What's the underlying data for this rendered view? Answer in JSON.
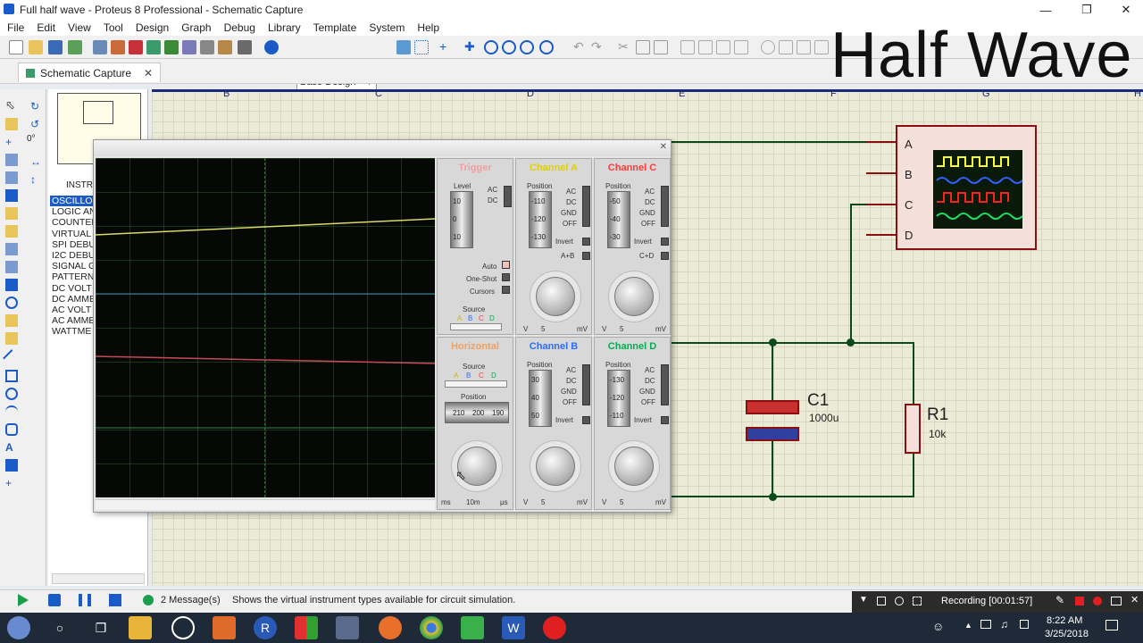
{
  "window": {
    "title": "Full half wave - Proteus 8 Professional - Schematic Capture"
  },
  "menu": [
    "File",
    "Edit",
    "View",
    "Tool",
    "Design",
    "Graph",
    "Debug",
    "Library",
    "Template",
    "System",
    "Help"
  ],
  "toolbar": {
    "design_select": "Base Design"
  },
  "tab": {
    "label": "Schematic Capture"
  },
  "overlay_text": "Half Wave",
  "left_panel": {
    "rotation": "0°",
    "header": "INSTR",
    "devices": [
      "OSCILLOS",
      "LOGIC AN",
      "COUNTER",
      "VIRTUAL",
      "SPI DEBU",
      "I2C DEBU",
      "SIGNAL G",
      "PATTERN",
      "DC VOLT",
      "DC AMME",
      "AC VOLT",
      "AC AMME",
      "WATTME"
    ]
  },
  "ruler": [
    "B",
    "C",
    "D",
    "E",
    "F",
    "G",
    "H"
  ],
  "scope": {
    "trigger": {
      "title": "Trigger",
      "level_label": "Level",
      "ac": "AC",
      "dc": "DC",
      "level_ticks": [
        "10",
        "0",
        "10"
      ],
      "auto": "Auto",
      "one_shot": "One-Shot",
      "cursors": "Cursors",
      "source_label": "Source",
      "sources": [
        "A",
        "B",
        "C",
        "D"
      ]
    },
    "horizontal": {
      "title": "Horizontal",
      "source_label": "Source",
      "sources": [
        "A",
        "B",
        "C",
        "D"
      ],
      "position_label": "Position",
      "position_ticks": [
        "210",
        "200",
        "190"
      ],
      "units": [
        "ms",
        "10m",
        "µs"
      ]
    },
    "channels": [
      {
        "title": "Channel A",
        "color": "#f2e600",
        "position_label": "Position",
        "ticks": [
          "-110",
          "-120",
          "-130"
        ],
        "modes": [
          "AC",
          "DC",
          "GND",
          "OFF"
        ],
        "invert": "Invert",
        "extra": "A+B",
        "units": [
          "V",
          "5",
          "mV"
        ]
      },
      {
        "title": "Channel C",
        "color": "#ff3b3b",
        "position_label": "Position",
        "ticks": [
          "-50",
          "-40",
          "-30"
        ],
        "modes": [
          "AC",
          "DC",
          "GND",
          "OFF"
        ],
        "invert": "Invert",
        "extra": "C+D",
        "units": [
          "V",
          "5",
          "mV"
        ]
      },
      {
        "title": "Channel B",
        "color": "#2e6bff",
        "position_label": "Position",
        "ticks": [
          "30",
          "40",
          "50"
        ],
        "modes": [
          "AC",
          "DC",
          "GND",
          "OFF"
        ],
        "invert": "Invert",
        "units": [
          "V",
          "5",
          "mV"
        ]
      },
      {
        "title": "Channel D",
        "color": "#00d060",
        "position_label": "Position",
        "ticks": [
          "-130",
          "-120",
          "-110"
        ],
        "modes": [
          "AC",
          "DC",
          "GND",
          "OFF"
        ],
        "invert": "Invert",
        "units": [
          "V",
          "5",
          "mV"
        ]
      }
    ],
    "trace_colors": {
      "a": "#d9d96a",
      "b": "#3a8ab0",
      "c": "#c84a5a",
      "d": "#3a8050"
    }
  },
  "schematic": {
    "scope_pins": [
      "A",
      "B",
      "C",
      "D"
    ],
    "capacitor": {
      "ref": "C1",
      "value": "1000u"
    },
    "resistor": {
      "ref": "R1",
      "value": "10k"
    }
  },
  "status": {
    "messages": "2 Message(s)",
    "hint": "Shows the virtual instrument types available for circuit simulation."
  },
  "recorder": {
    "label": "Recording [00:01:57]"
  },
  "taskbar": {
    "time": "8:22 AM",
    "date": "3/25/2018"
  }
}
